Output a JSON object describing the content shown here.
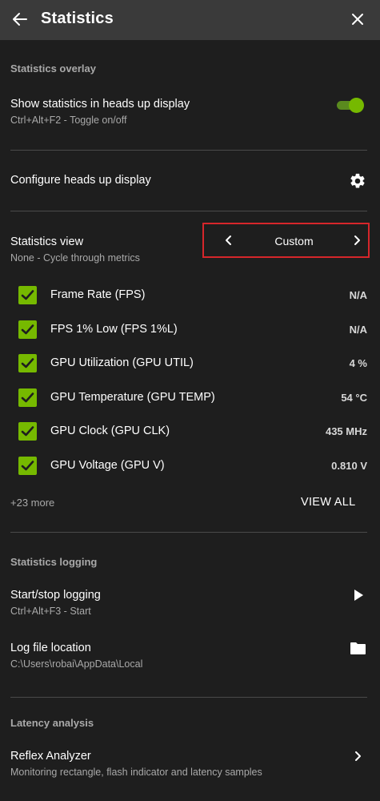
{
  "header": {
    "title": "Statistics"
  },
  "overlay": {
    "section_label": "Statistics overlay",
    "show_title": "Show statistics in heads up display",
    "show_sub": "Ctrl+Alt+F2 - Toggle on/off",
    "toggle_on": true,
    "configure_title": "Configure heads up display"
  },
  "view": {
    "title": "Statistics view",
    "sub": "None - Cycle through metrics",
    "selected": "Custom"
  },
  "metrics": [
    {
      "name": "Frame Rate (FPS)",
      "value": "N/A",
      "checked": true
    },
    {
      "name": "FPS 1% Low (FPS 1%L)",
      "value": "N/A",
      "checked": true
    },
    {
      "name": "GPU Utilization (GPU UTIL)",
      "value": "4 %",
      "checked": true
    },
    {
      "name": "GPU Temperature (GPU TEMP)",
      "value": "54 °C",
      "checked": true
    },
    {
      "name": "GPU Clock (GPU CLK)",
      "value": "435 MHz",
      "checked": true
    },
    {
      "name": "GPU Voltage (GPU V)",
      "value": "0.810 V",
      "checked": true
    }
  ],
  "more": {
    "label": "+23 more",
    "view_all": "VIEW ALL"
  },
  "logging": {
    "section_label": "Statistics logging",
    "start_title": "Start/stop logging",
    "start_sub": "Ctrl+Alt+F3 - Start",
    "location_title": "Log file location",
    "location_sub": "C:\\Users\\robai\\AppData\\Local"
  },
  "latency": {
    "section_label": "Latency analysis",
    "reflex_title": "Reflex Analyzer",
    "reflex_sub": "Monitoring rectangle, flash indicator and latency samples"
  },
  "colors": {
    "accent": "#76b900",
    "highlight": "#d6262b",
    "background": "#1e1e1e",
    "header": "#3a3a3a"
  }
}
